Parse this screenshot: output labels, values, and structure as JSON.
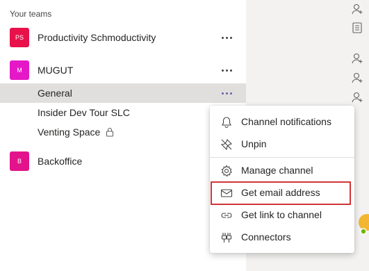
{
  "sidebar": {
    "section_title": "Your teams",
    "teams": [
      {
        "initials": "PS",
        "name": "Productivity Schmoductivity",
        "color": "#e8114a"
      },
      {
        "initials": "M",
        "name": "MUGUT",
        "color": "#e518c7",
        "channels": [
          "General",
          "Insider Dev Tour SLC",
          "Venting Space"
        ]
      },
      {
        "initials": "B",
        "name": "Backoffice",
        "color": "#e3138b"
      }
    ]
  },
  "context_menu": {
    "items": [
      {
        "label": "Channel notifications",
        "icon": "bell-icon"
      },
      {
        "label": "Unpin",
        "icon": "unpin-icon"
      },
      {
        "label": "Manage channel",
        "icon": "gear-icon"
      },
      {
        "label": "Get email address",
        "icon": "mail-icon",
        "highlighted": true
      },
      {
        "label": "Get link to channel",
        "icon": "link-icon"
      },
      {
        "label": "Connectors",
        "icon": "connector-icon"
      }
    ]
  },
  "colors": {
    "accent": "#6264a7",
    "highlight": "#d13438",
    "selected_row": "#e1dfdd"
  }
}
